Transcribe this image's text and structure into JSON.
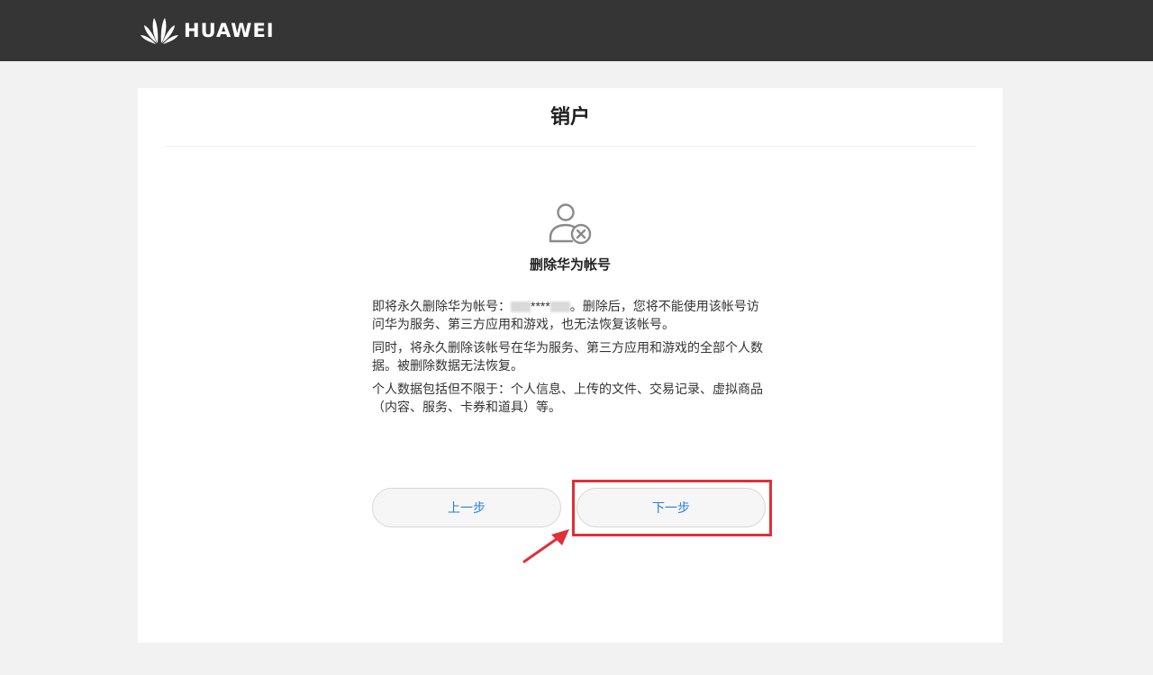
{
  "header": {
    "brand": "HUAWEI"
  },
  "page": {
    "title": "销户"
  },
  "section": {
    "icon": "user-remove-icon",
    "title": "删除华为帐号"
  },
  "content": {
    "para1_before": "即将永久删除华为帐号：",
    "para1_mask": "****",
    "para1_after": "。删除后，您将不能使用该帐号访问华为服务、第三方应用和游戏，也无法恢复该帐号。",
    "para2": "同时，将永久删除该帐号在华为服务、第三方应用和游戏的全部个人数据。被删除数据无法恢复。",
    "para3": "个人数据包括但不限于：个人信息、上传的文件、交易记录、虚拟商品（内容、服务、卡券和道具）等。"
  },
  "buttons": {
    "prev_label": "上一步",
    "next_label": "下一步"
  },
  "colors": {
    "topbar": "#353535",
    "link_blue": "#2a7fd5",
    "highlight_red": "#e0303a"
  }
}
